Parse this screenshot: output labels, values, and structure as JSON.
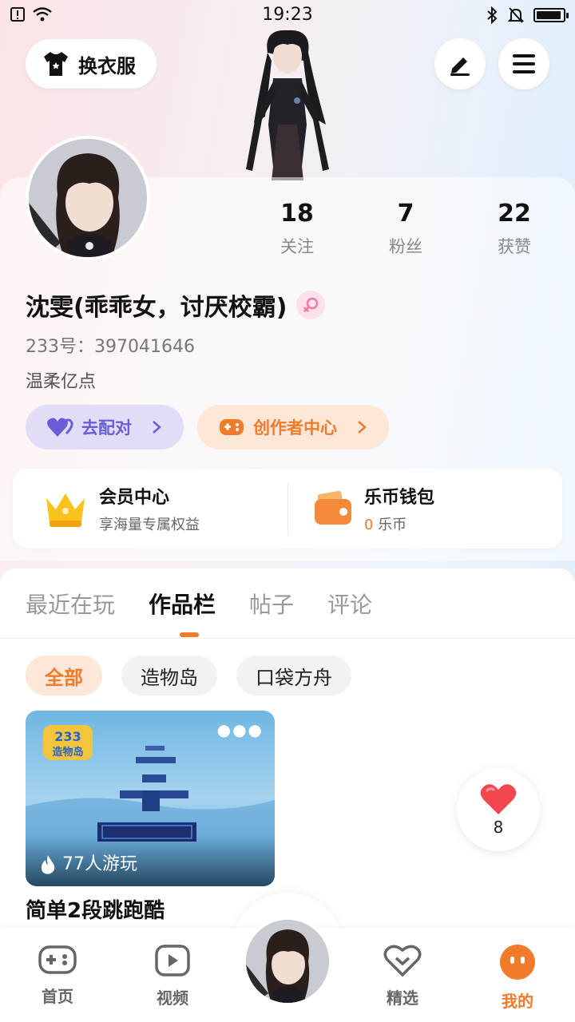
{
  "status_bar": {
    "time": "19:23",
    "battery_level": 0.85
  },
  "header": {
    "outfit_label": "换衣服",
    "icons": [
      "tshirt-icon",
      "edit-icon",
      "menu-icon"
    ]
  },
  "profile": {
    "stats": [
      {
        "value": "18",
        "label": "关注"
      },
      {
        "value": "7",
        "label": "粉丝"
      },
      {
        "value": "22",
        "label": "获赞"
      }
    ],
    "name": "沈雯(乖乖女，讨厌校霸)",
    "gender_icon": "female-icon",
    "uid": "233号：397041646",
    "bio": "温柔亿点",
    "match_label": "去配对",
    "creator_label": "创作者中心"
  },
  "vip": {
    "member_title": "会员中心",
    "member_sub": "享海量专属权益",
    "wallet_title": "乐币钱包",
    "wallet_coins": "0",
    "wallet_unit": "乐币"
  },
  "tabs": [
    "最近在玩",
    "作品栏",
    "帖子",
    "评论"
  ],
  "active_tab": "作品栏",
  "filters": [
    "全部",
    "造物岛",
    "口袋方舟"
  ],
  "active_filter": "全部",
  "work": {
    "logo_text": "233造物岛",
    "plays": "77人游玩",
    "title": "简单2段跳跑酷",
    "likes": "8"
  },
  "bottom_nav": [
    {
      "label": "首页",
      "icon": "gamepad-icon"
    },
    {
      "label": "视频",
      "icon": "play-icon"
    },
    {
      "label": "精选",
      "icon": "heart-check-icon"
    },
    {
      "label": "我的",
      "icon": "face-icon"
    }
  ],
  "colors": {
    "accent": "#f07b2a",
    "purple": "#6a5ed6"
  }
}
